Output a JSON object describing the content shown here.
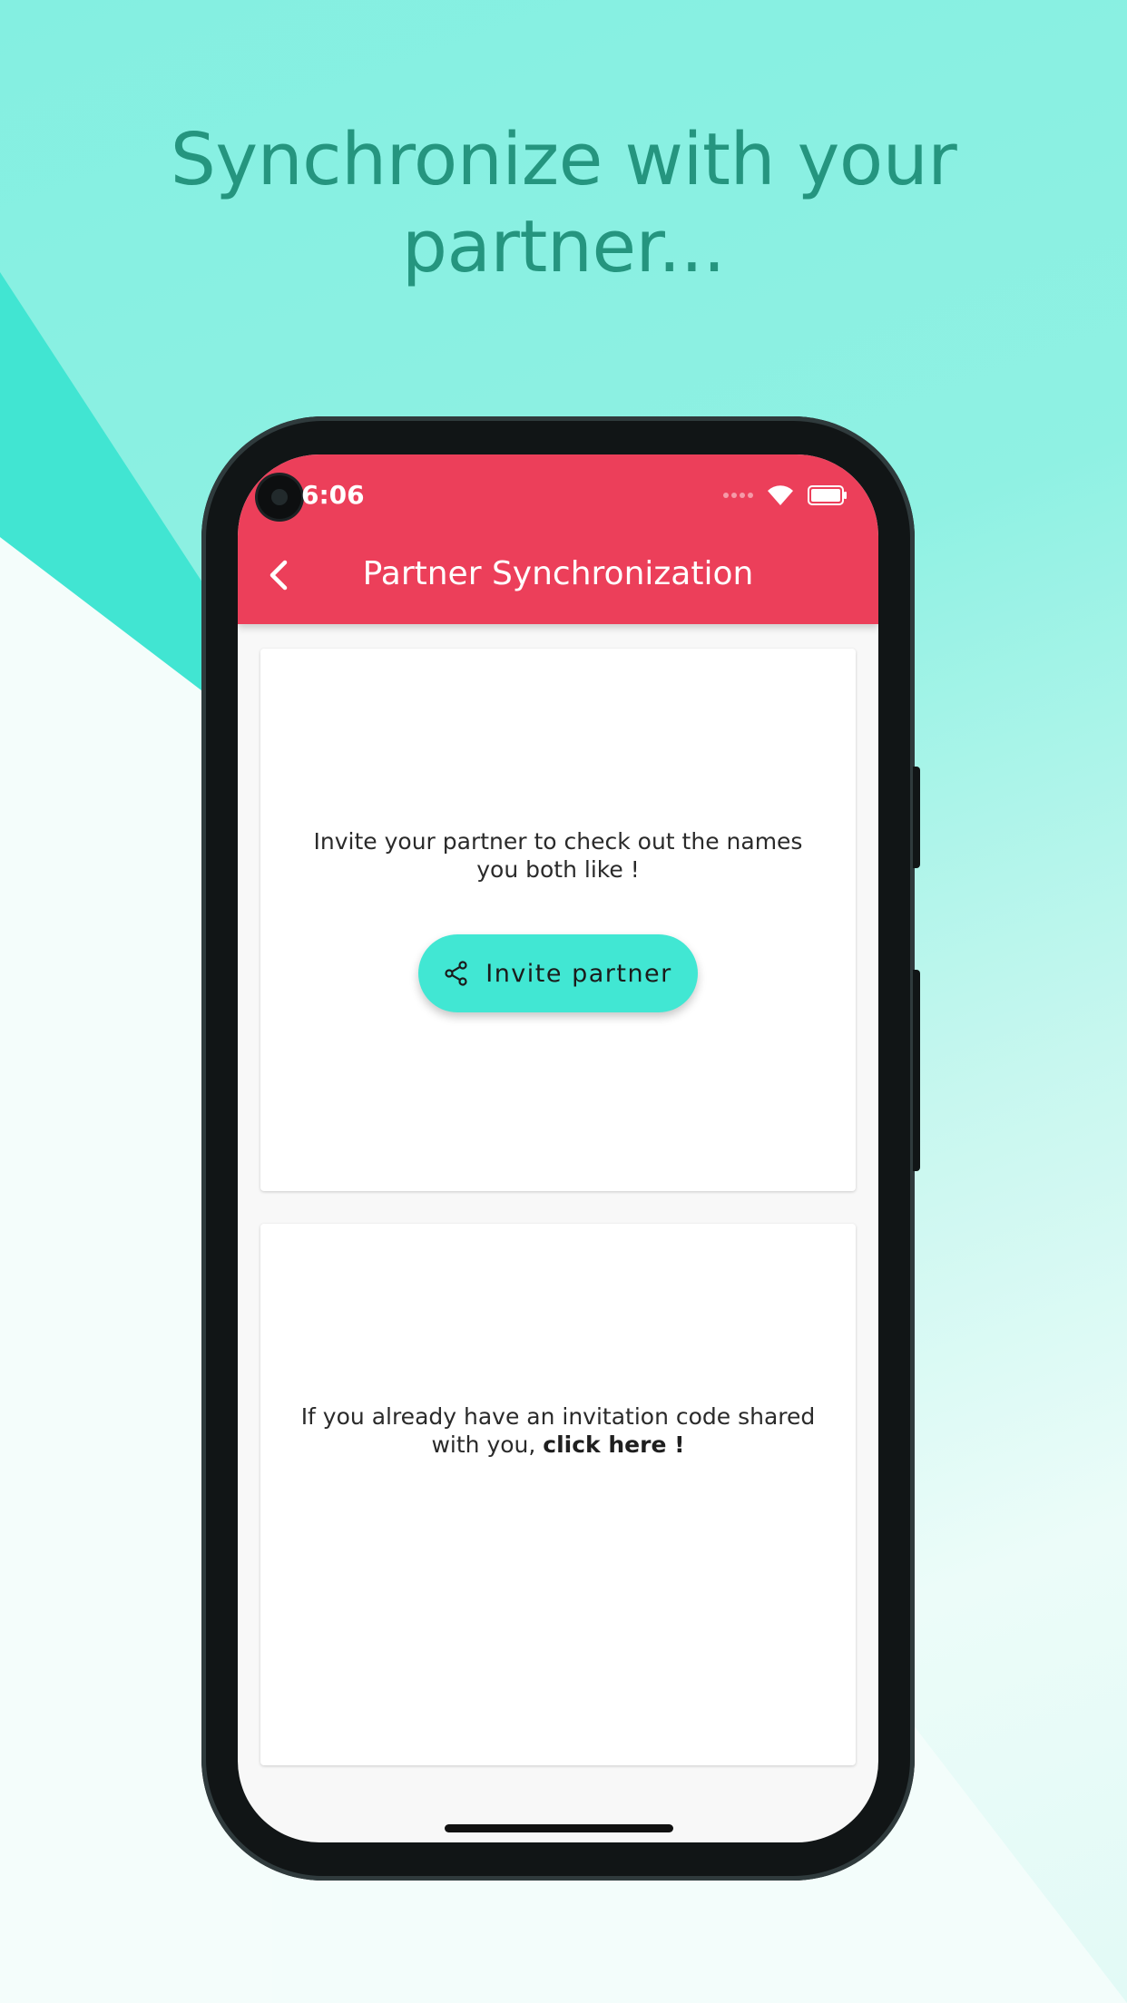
{
  "headline": {
    "line1": "Synchronize with your",
    "line2": "partner..."
  },
  "status_bar": {
    "time": "6:06",
    "icons": [
      "signal-dots-icon",
      "wifi-icon",
      "battery-icon"
    ]
  },
  "app_bar": {
    "title": "Partner Synchronization",
    "back_icon": "chevron-left-icon",
    "color": "#ec3f5a"
  },
  "invite_card": {
    "text": "Invite your partner to check out the names you both like !",
    "button_label": "Invite partner",
    "button_icon": "share-icon",
    "button_color": "#41e7d3"
  },
  "code_card": {
    "text_prefix": "If you already have an invitation code shared with you, ",
    "link_text": "click here !"
  },
  "colors": {
    "headline": "#25957f",
    "accent": "#41e7d3"
  }
}
